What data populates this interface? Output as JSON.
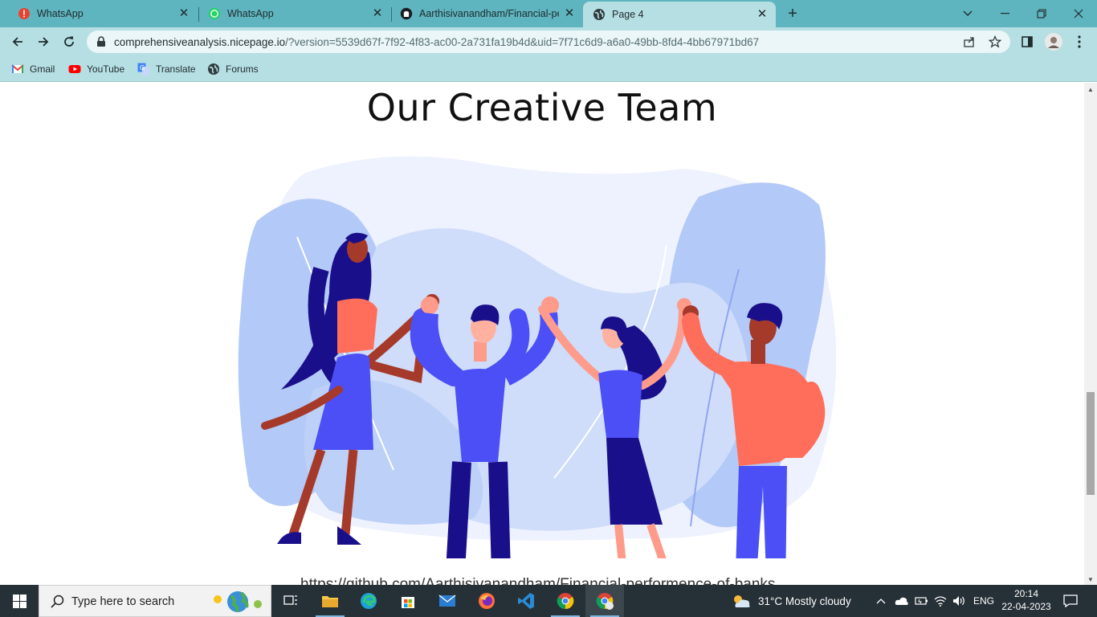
{
  "browser": {
    "tabs": [
      {
        "title": "WhatsApp",
        "icon": "whatsapp-alert-icon"
      },
      {
        "title": "WhatsApp",
        "icon": "whatsapp-icon"
      },
      {
        "title": "Aarthisivanandham/Financial-per",
        "icon": "github-icon"
      },
      {
        "title": "Page 4",
        "icon": "globe-icon",
        "active": true
      }
    ],
    "new_tab": "+",
    "url_host": "comprehensiveanalysis.nicepage.io",
    "url_rest": "/?version=5539d67f-7f92-4f83-ac00-2a731fa19b4d&uid=7f71c6d9-a6a0-49bb-8fd4-4bb67971bd67",
    "bookmarks": [
      {
        "label": "Gmail",
        "icon": "gmail-icon"
      },
      {
        "label": "YouTube",
        "icon": "youtube-icon"
      },
      {
        "label": "Translate",
        "icon": "translate-icon"
      },
      {
        "label": "Forums",
        "icon": "globe-icon"
      }
    ]
  },
  "page": {
    "heading": "Our Creative Team",
    "link_text": "https://github.com/Aarthisivanandham/Financial-performence-of-banks"
  },
  "taskbar": {
    "search_placeholder": "Type here to search",
    "weather": "31°C  Mostly cloudy",
    "language": "ENG",
    "time": "20:14",
    "date": "22-04-2023"
  },
  "colors": {
    "tab_strip": "#5eb4bf",
    "toolbar": "#b6dfe4",
    "taskbar": "#263037",
    "illus_blue": "#4b4ff5",
    "illus_coral": "#ff6e5a",
    "illus_navy": "#1a0f8a"
  }
}
